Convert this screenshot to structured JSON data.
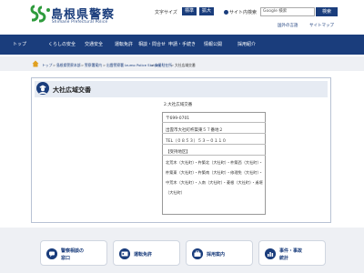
{
  "header": {
    "logo_title": "島根県警察",
    "logo_sub": "Shimane Prefectural Police",
    "font_size_label": "文字サイズ",
    "font_standard": "標準",
    "font_large": "拡大",
    "site_search_label": "サイト内検索",
    "search_placeholder": "Google 検索",
    "search_button": "検索",
    "foreign_language_link": "国外の言語",
    "sitemap_link": "サイトマップ"
  },
  "nav": {
    "items": [
      {
        "label": "トップ"
      },
      {
        "label": "くらしの安全"
      },
      {
        "label": "交通安全"
      },
      {
        "label": "運転免許"
      },
      {
        "label": "相談・問合せ"
      },
      {
        "label": "申請・手続き"
      },
      {
        "label": "情報公開"
      },
      {
        "label": "採用紹介"
      }
    ]
  },
  "breadcrumb": {
    "items": [
      "トップ",
      "島根県警察本部",
      "警察署案内",
      "出雲警察署 Izumo Police Station",
      "交番駐在所",
      "大社広域交番"
    ]
  },
  "main": {
    "heading": "大社広域交番",
    "info_title": "2.大社広域交番",
    "postal": "〒699-0701",
    "address": "出雲市大社町杵築東５７番地２",
    "tel": "TEL（０８５３）５３－０１１０",
    "jurisdiction_label": "【受持地区】",
    "jurisdiction_lines": [
      "北荒木（大社町）・杵築北（大社町）・杵築西（大社町）・",
      "杵築東（大社町）・杵築南（大社町）・修理免（大社町）・",
      "中荒木（大社町）・入南（大社町）・菱根（大社町）・遙堪",
      "（大社町）"
    ]
  },
  "cards": [
    {
      "label": "警察相談の\n窓口",
      "label_line1": "警察相談の",
      "label_line2": "窓口",
      "icon": "chat-icon"
    },
    {
      "label": "運転免許",
      "icon": "license-icon"
    },
    {
      "label": "採用案内",
      "icon": "briefcase-icon"
    },
    {
      "label": "事件・事故\n統計",
      "label_line1": "事件・事故",
      "label_line2": "統計",
      "icon": "chart-icon"
    }
  ],
  "colors": {
    "brand_navy": "#1a3d7c",
    "logo_green": "#2e9b3c",
    "breadcrumb_bg": "#eef0f4",
    "heading_bg": "#e6ebf3"
  }
}
